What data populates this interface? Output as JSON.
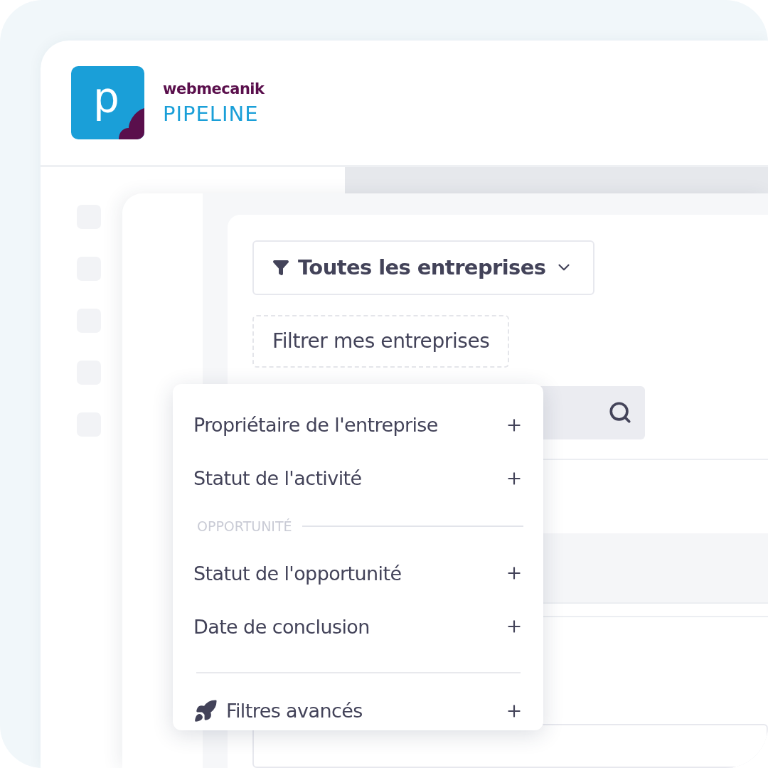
{
  "logo": {
    "letter": "p",
    "brand": "webmecanik",
    "product": "PIPELINE"
  },
  "filter_dropdown": {
    "label": "Toutes les entreprises"
  },
  "my_filter_button": {
    "label": "Filtrer mes entreprises"
  },
  "filter_menu": {
    "items": [
      {
        "kind": "option",
        "label": "Propriétaire de l'entreprise"
      },
      {
        "kind": "option",
        "label": "Statut de l'activité"
      },
      {
        "kind": "section",
        "label": "OPPORTUNITÉ"
      },
      {
        "kind": "option",
        "label": "Statut de l'opportunité"
      },
      {
        "kind": "option",
        "label": "Date de conclusion"
      },
      {
        "kind": "divider"
      },
      {
        "kind": "advanced",
        "label": "Filtres avancés"
      }
    ]
  }
}
